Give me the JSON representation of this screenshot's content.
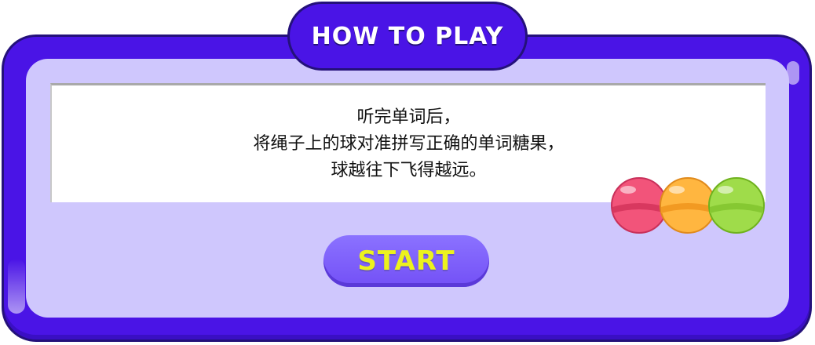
{
  "title": "HOW TO PLAY",
  "instructions": [
    "听完单词后，",
    "将绳子上的球对准拼写正确的单词糖果，",
    "球越往下飞得越远。"
  ],
  "start_label": "START",
  "colors": {
    "frame": "#4a14e6",
    "frame_border": "#24117a",
    "panel": "#cfc7fd",
    "button": "#7d5cfb",
    "button_text": "#ecf21d"
  },
  "candies": [
    {
      "name": "pink-candy-icon",
      "color": "#f2547a"
    },
    {
      "name": "orange-candy-icon",
      "color": "#ffb640"
    },
    {
      "name": "green-candy-icon",
      "color": "#9fdc4a"
    }
  ]
}
